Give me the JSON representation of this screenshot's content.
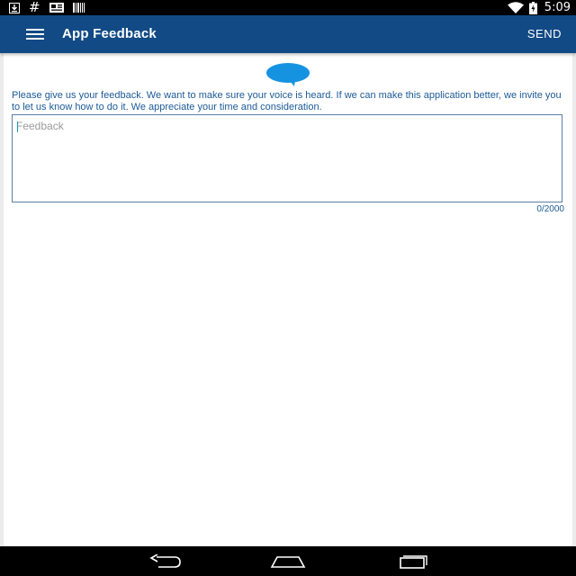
{
  "status_bar": {
    "time": "5:09",
    "left_icons": [
      "download-icon",
      "hash-icon",
      "news-icon",
      "barcode-icon"
    ],
    "right_icons": [
      "wifi-icon",
      "battery-charging-icon"
    ]
  },
  "app_bar": {
    "menu_icon": "hamburger-menu-icon",
    "title": "App Feedback",
    "send_label": "SEND",
    "background": "#124a85"
  },
  "main": {
    "icon": "speech-bubble-icon",
    "icon_color": "#1693e0",
    "intro": "Please give us your feedback. We want to make sure your voice is heard. If we can make this application better, we invite you to let us know how to do it. We appreciate your time and consideration.",
    "feedback_placeholder": "Feedback",
    "feedback_value": "",
    "counter": "0/2000"
  },
  "nav_bar": {
    "buttons": [
      "back-icon",
      "home-icon",
      "recents-icon"
    ]
  }
}
